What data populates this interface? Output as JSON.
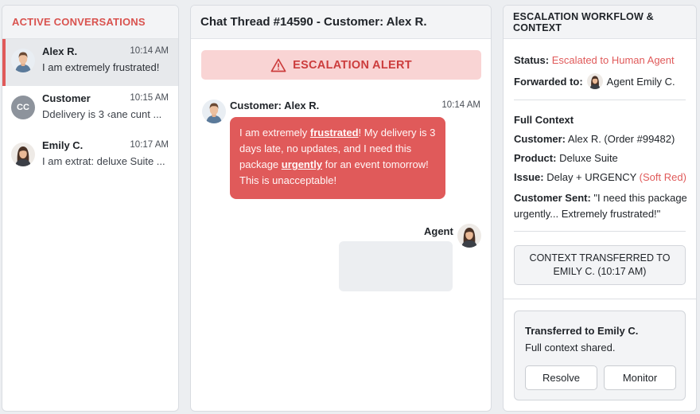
{
  "colors": {
    "accent_red": "#e05a5a",
    "alert_bg": "#f9d4d4",
    "panel_bg": "#ffffff",
    "page_bg": "#eceef1"
  },
  "sidebar": {
    "title": "ACTIVE CONVERSATIONS",
    "items": [
      {
        "name": "Alex R.",
        "time": "10:14 AM",
        "preview": "I am extremely frustrated!",
        "avatar": "man-avatar-icon",
        "active": true
      },
      {
        "name": "Customer",
        "time": "10:15 AM",
        "preview": "Ddelivery is 3 ‹ane cunt ...",
        "avatar_initials": "CC",
        "active": false
      },
      {
        "name": "Emily C.",
        "time": "10:17 AM",
        "preview": "I am extrat: deluxe Suite ...",
        "avatar": "woman-avatar-icon",
        "active": false
      }
    ]
  },
  "thread": {
    "title": "Chat Thread #14590 - Customer: Alex R.",
    "alert_label": "ESCALATION ALERT",
    "alert_icon": "warning-triangle-icon",
    "customer_message": {
      "sender": "Customer: Alex R.",
      "time": "10:14 AM",
      "text_1": "I am extremely ",
      "emph_1": "frustrated",
      "text_2": "! My delivery is 3 days late, no updates, and I need this package ",
      "emph_2": "urgently",
      "text_3": " for an event tomorrow! This is unacceptable!"
    },
    "agent_message": {
      "sender": "Agent",
      "text": ""
    }
  },
  "escalation": {
    "title": "ESCALATION WORKFLOW & CONTEXT",
    "status_label": "Status:",
    "status_value": "Escalated to Human Agent",
    "forwarded_label": "Forwarded to:",
    "forwarded_value": "Agent Emily C.",
    "context_heading": "Full Context",
    "customer_label": "Customer:",
    "customer_value": "Alex R. (Order #99482)",
    "product_label": "Product:",
    "product_value": "Deluxe Suite",
    "issue_label": "Issue:",
    "issue_value": "Delay + URGENCY",
    "issue_tag": "(Soft Red)",
    "sent_label": "Customer Sent:",
    "sent_value_1": "\"I need this package",
    "sent_value_2": "urgently... Extremely frustrated!\"",
    "transfer_status_1": "CONTEXT TRANSFERRED TO",
    "transfer_status_2": "EMILY C. (10:17 AM)",
    "transfer_title": "Transferred to Emily C.",
    "transfer_sub": "Full context shared.",
    "resolve_label": "Resolve",
    "monitor_label": "Monitor"
  }
}
